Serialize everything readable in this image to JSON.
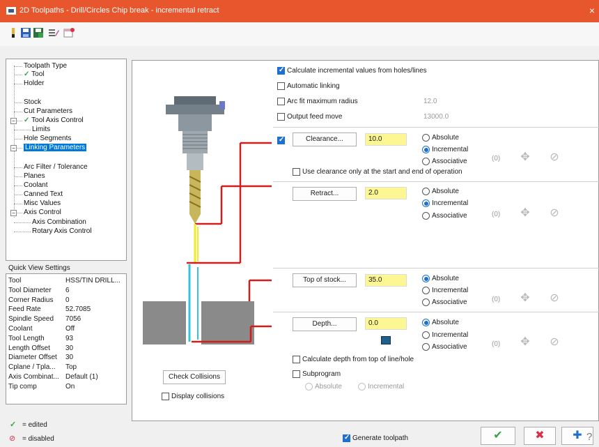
{
  "window": {
    "title": "2D Toolpaths - Drill/Circles Chip break - incremental retract",
    "close_glyph": "×"
  },
  "tree": {
    "items": [
      {
        "label": "Toolpath Type",
        "checked": false
      },
      {
        "label": "Tool",
        "checked": true
      },
      {
        "label": "Holder",
        "checked": false
      },
      {
        "label": "Stock",
        "checked": false
      },
      {
        "label": "Cut Parameters",
        "checked": false
      },
      {
        "label": "Tool Axis Control",
        "checked": true
      },
      {
        "label": "Limits",
        "checked": false
      },
      {
        "label": "Hole Segments",
        "checked": false
      },
      {
        "label": "Linking Parameters",
        "checked": false,
        "selected": true
      },
      {
        "label": "Arc Filter / Tolerance",
        "checked": false
      },
      {
        "label": "Planes",
        "checked": false
      },
      {
        "label": "Coolant",
        "checked": false
      },
      {
        "label": "Canned Text",
        "checked": false
      },
      {
        "label": "Misc Values",
        "checked": false
      },
      {
        "label": "Axis Control",
        "checked": false
      },
      {
        "label": "Axis Combination",
        "checked": false
      },
      {
        "label": "Rotary Axis Control",
        "checked": false
      }
    ]
  },
  "quick_view": {
    "title": "Quick View Settings",
    "rows": [
      {
        "key": "Tool",
        "value": "HSS/TIN DRILL..."
      },
      {
        "key": "Tool Diameter",
        "value": "6"
      },
      {
        "key": "Corner Radius",
        "value": "0"
      },
      {
        "key": "Feed Rate",
        "value": "52.7085"
      },
      {
        "key": "Spindle Speed",
        "value": "7056"
      },
      {
        "key": "Coolant",
        "value": "Off"
      },
      {
        "key": "Tool Length",
        "value": "93"
      },
      {
        "key": "Length Offset",
        "value": "30"
      },
      {
        "key": "Diameter Offset",
        "value": "30"
      },
      {
        "key": "Cplane / Tpla...",
        "value": "Top"
      },
      {
        "key": "Axis Combinat...",
        "value": "Default (1)"
      },
      {
        "key": "Tip comp",
        "value": "On"
      }
    ]
  },
  "legend": {
    "edited": "= edited",
    "disabled": "= disabled"
  },
  "options": {
    "calc_incremental": {
      "label": "Calculate incremental values from holes/lines",
      "checked": true
    },
    "auto_linking": {
      "label": "Automatic linking",
      "checked": false
    },
    "arc_fit": {
      "label": "Arc fit maximum radius",
      "checked": false,
      "value": "12.0"
    },
    "output_feed": {
      "label": "Output feed move",
      "checked": false,
      "value": "13000.0"
    }
  },
  "clearance": {
    "enabled": true,
    "button": "Clearance...",
    "value": "10.0",
    "mode": "Incremental",
    "count": "(0)",
    "only_start_end": {
      "label": "Use clearance only at the start and end of operation",
      "checked": false
    }
  },
  "retract": {
    "button": "Retract...",
    "value": "2.0",
    "mode": "Incremental",
    "count": "(0)"
  },
  "top_of_stock": {
    "button": "Top of stock...",
    "value": "35.0",
    "mode": "Absolute",
    "count": "(0)"
  },
  "depth": {
    "button": "Depth...",
    "value": "0.0",
    "mode": "Absolute",
    "count": "(0)",
    "calc_from_top": {
      "label": "Calculate depth from top of line/hole",
      "checked": false
    }
  },
  "radio_labels": {
    "absolute": "Absolute",
    "incremental": "Incremental",
    "associative": "Associative"
  },
  "subprogram": {
    "label": "Subprogram",
    "checked": false,
    "absolute": "Absolute",
    "incremental": "Incremental"
  },
  "check_collisions": "Check Collisions",
  "display_collisions": {
    "label": "Display collisions",
    "checked": false
  },
  "generate_toolpath": {
    "label": "Generate toolpath",
    "checked": true
  },
  "footer_buttons": {
    "ok": "✔",
    "cancel": "✖",
    "add": "✚",
    "help": "?"
  },
  "colors": {
    "accent": "#e8562d",
    "selection": "#0078d7",
    "field": "#fdf793",
    "check": "#3aa04a"
  }
}
